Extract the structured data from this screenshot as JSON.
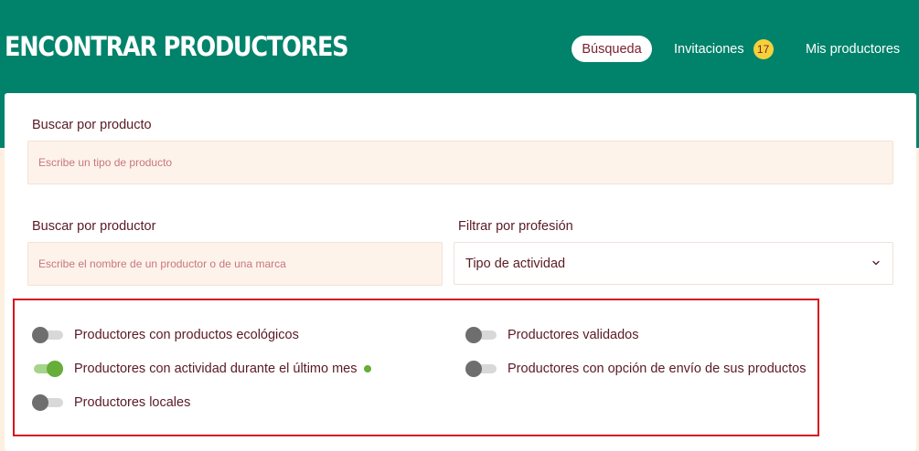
{
  "header": {
    "title": "ENCONTRAR PRODUCTORES",
    "nav": {
      "busqueda": "Búsqueda",
      "invitaciones": "Invitaciones",
      "invitaciones_count": "17",
      "mis_productores": "Mis productores"
    }
  },
  "search": {
    "producto_label": "Buscar por producto",
    "producto_placeholder": "Escribe un tipo de producto",
    "productor_label": "Buscar por productor",
    "productor_placeholder": "Escribe el nombre de un productor o de una marca",
    "profesion_label": "Filtrar por profesión",
    "profesion_value": "Tipo de actividad"
  },
  "filters": {
    "ecologicos": {
      "label": "Productores con productos ecológicos",
      "on": false
    },
    "actividad": {
      "label": "Productores con actividad durante el último mes",
      "on": true
    },
    "locales": {
      "label": "Productores locales",
      "on": false
    },
    "validados": {
      "label": "Productores validados",
      "on": false
    },
    "envio": {
      "label": "Productores con opción de envío de sus productos",
      "on": false
    }
  },
  "colors": {
    "header": "#00826b",
    "accent_green": "#66ad3a",
    "text": "#5a1a24",
    "highlight_border": "#d9141c"
  }
}
